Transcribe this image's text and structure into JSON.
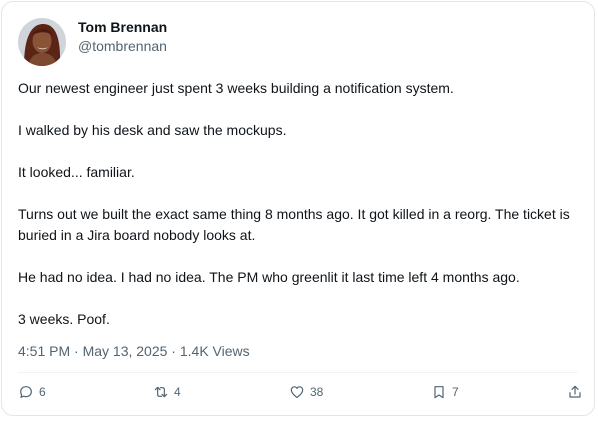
{
  "author": {
    "name": "Tom Brennan",
    "handle": "@tombrennan"
  },
  "post": {
    "paragraphs": [
      "Our newest engineer just spent 3 weeks building a notification system.",
      "I walked by his desk and saw the mockups.",
      "It looked... familiar.",
      "Turns out we built the exact same thing 8 months ago. It got killed in a reorg. The ticket is buried in a Jira board nobody looks at.",
      "He had no idea. I had no idea. The PM who greenlit it last time left 4 months ago.",
      "3 weeks. Poof."
    ],
    "meta": "4:51 PM · May 13, 2025 · 1.4K Views"
  },
  "actions": {
    "reply": {
      "icon": "reply-icon",
      "count": "6"
    },
    "repost": {
      "icon": "repost-icon",
      "count": "4"
    },
    "like": {
      "icon": "heart-icon",
      "count": "38"
    },
    "bookmark": {
      "icon": "bookmark-icon",
      "count": "7"
    },
    "share": {
      "icon": "share-icon"
    }
  },
  "colors": {
    "text": "#0f1419",
    "secondary": "#536471",
    "border": "#e1e5e9"
  }
}
